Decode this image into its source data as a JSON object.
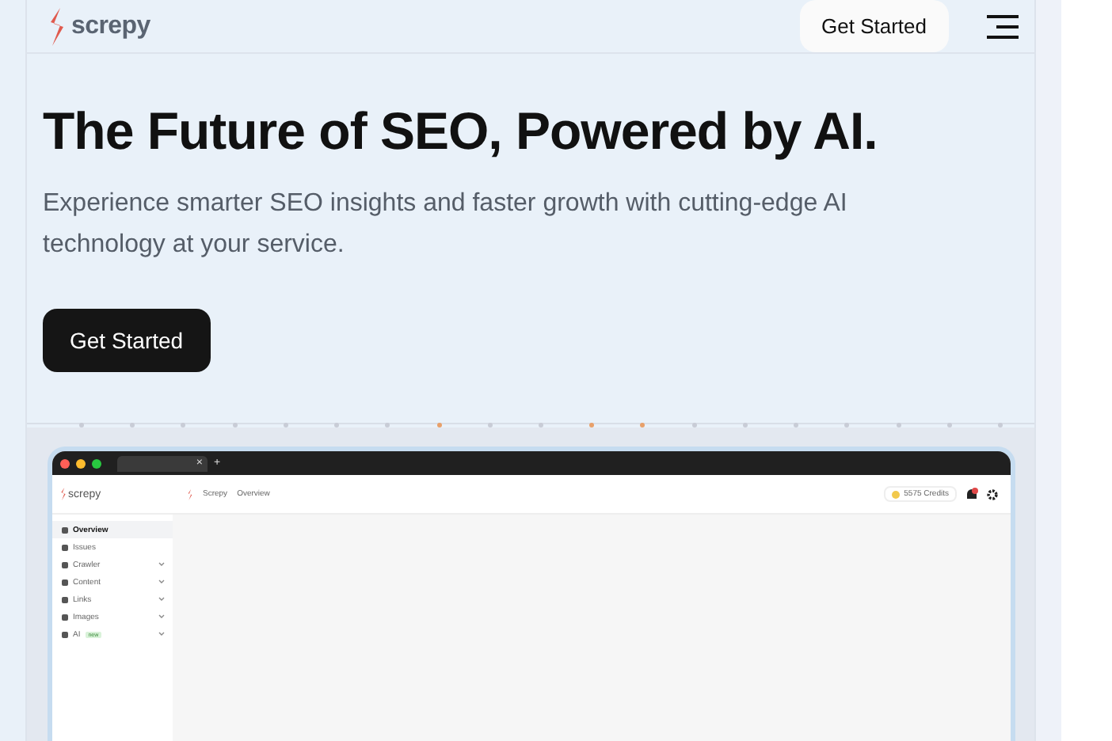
{
  "header": {
    "logo": "screpy",
    "cta": "Get Started"
  },
  "hero": {
    "title": "The Future of SEO, Powered by AI.",
    "subtitle": "Experience smarter SEO insights and faster growth with cutting-edge AI technology at your service.",
    "cta": "Get Started"
  },
  "dots": [
    {
      "color": "#c8ccd6"
    },
    {
      "color": "#c8ccd6"
    },
    {
      "color": "#c8ccd6"
    },
    {
      "color": "#c8ccd6"
    },
    {
      "color": "#c8ccd6"
    },
    {
      "color": "#c8ccd6"
    },
    {
      "color": "#c8ccd6"
    },
    {
      "color": "#e8a06a"
    },
    {
      "color": "#c8ccd6"
    },
    {
      "color": "#c8ccd6"
    },
    {
      "color": "#e8a06a"
    },
    {
      "color": "#e8a06a"
    },
    {
      "color": "#c8ccd6"
    },
    {
      "color": "#c8ccd6"
    },
    {
      "color": "#c8ccd6"
    },
    {
      "color": "#c8ccd6"
    },
    {
      "color": "#c8ccd6"
    },
    {
      "color": "#c8ccd6"
    },
    {
      "color": "#c8ccd6"
    }
  ],
  "preview": {
    "tab_close": "×",
    "tab_new": "+",
    "logo": "screpy",
    "breadcrumb": [
      "Screpy",
      "Overview"
    ],
    "credits": "5575 Credits",
    "sidebar": [
      {
        "label": "Overview",
        "selected": true,
        "expandable": false
      },
      {
        "label": "Issues",
        "selected": false,
        "expandable": false
      },
      {
        "label": "Crawler",
        "selected": false,
        "expandable": true
      },
      {
        "label": "Content",
        "selected": false,
        "expandable": true
      },
      {
        "label": "Links",
        "selected": false,
        "expandable": true
      },
      {
        "label": "Images",
        "selected": false,
        "expandable": true
      },
      {
        "label": "AI",
        "badge": "new",
        "selected": false,
        "expandable": true
      }
    ]
  }
}
